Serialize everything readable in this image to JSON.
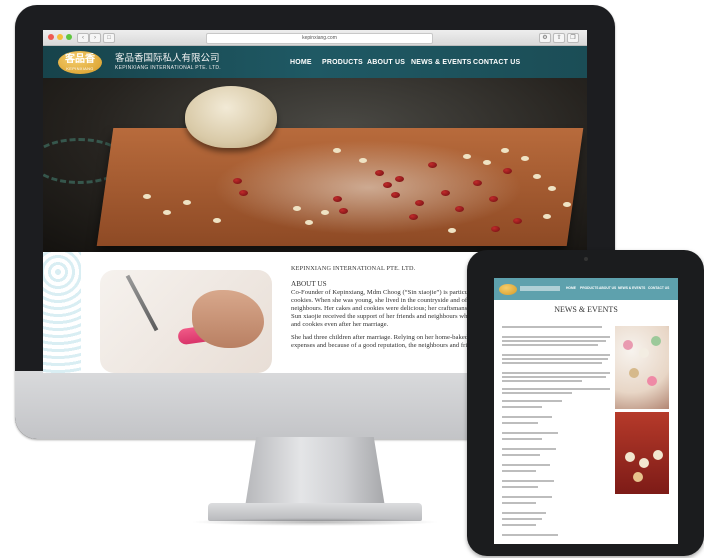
{
  "browser": {
    "url": "kepinxiang.com"
  },
  "site": {
    "logo_cn": "客品香",
    "logo_en": "KEPINXIANG",
    "company_cn": "客品香国际私人有限公司",
    "company_en": "KEPINXIANG INTERNATIONAL PTE. LTD.",
    "nav": [
      "HOME",
      "PRODUCTS",
      "ABOUT US",
      "NEWS & EVENTS",
      "CONTACT US"
    ]
  },
  "content": {
    "org_title": "KEPINXIANG INTERNATIONAL PTE. LTD.",
    "section_heading": "ABOUT US",
    "para1_lines": [
      "Co-Founder of Kepinxiang, Mdm Choog (“Sin xiaojie”) is particularly inter",
      "cookies. When she was young, she lived in the countryside and often made c",
      "neighbours. Her cakes and cookies were delicious; her craftsmanship was fa",
      "Sun xiaojie received the support of her friends and neighbours who continue",
      "and cookies even after her marriage."
    ],
    "para2_lines": [
      "She had three children after marriage. Relying on her home-baked cakes to s",
      "expenses and because of a good reputation, the neighbours and friends were"
    ]
  },
  "tablet": {
    "title": "NEWS & EVENTS",
    "nav": [
      "HOME",
      "PRODUCTS",
      "ABOUT US",
      "NEWS & EVENTS",
      "CONTACT US"
    ]
  },
  "colors": {
    "header_teal": "#1f5964",
    "tablet_header": "#5ea1ad",
    "logo_gold": "#e2a93b",
    "red_bean": "#8e1a1c"
  }
}
